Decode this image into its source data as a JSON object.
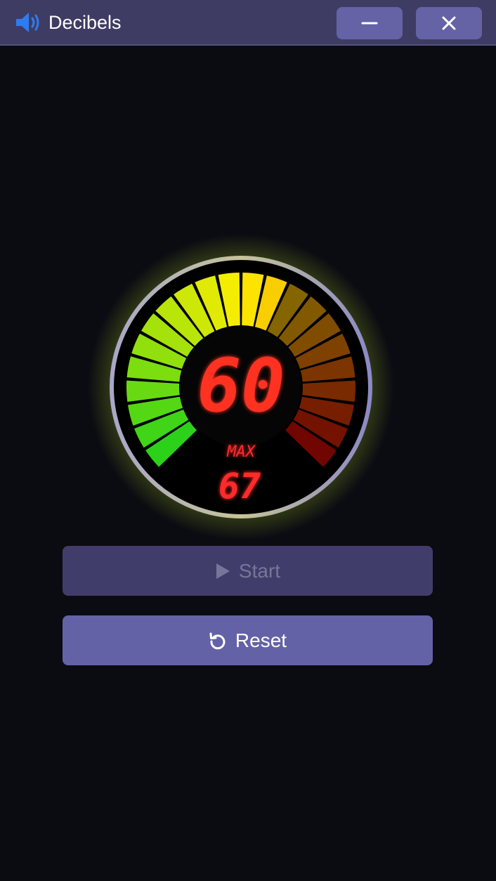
{
  "window": {
    "title": "Decibels",
    "app_icon": "speaker-icon",
    "minimize_icon": "minimize-icon",
    "close_icon": "close-icon"
  },
  "meter": {
    "current_db": "60",
    "max_label": "MAX",
    "max_db": "67",
    "level_fraction": 0.6,
    "colors": {
      "green": "#22d11a",
      "yellow": "#ffee00",
      "red": "#cc0000",
      "readout": "#ff2a2a",
      "ring": "#8a88c2"
    }
  },
  "controls": {
    "start_label": "Start",
    "start_icon": "play-icon",
    "start_enabled": false,
    "reset_label": "Reset",
    "reset_icon": "reset-icon"
  }
}
